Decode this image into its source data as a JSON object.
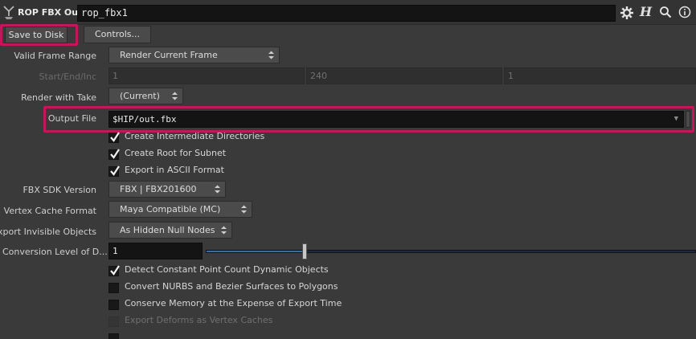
{
  "header": {
    "node_type": "ROP FBX Output",
    "node_name": "rop_fbx1",
    "icons": [
      "gear-icon",
      "help-icon",
      "search-icon",
      "info-icon"
    ]
  },
  "buttons": {
    "save_to_disk": "Save to Disk",
    "controls": "Controls..."
  },
  "params": {
    "valid_frame_range": {
      "label": "Valid Frame Range",
      "value": "Render Current Frame"
    },
    "start_end_inc": {
      "label": "Start/End/Inc",
      "start": "1",
      "end": "240",
      "inc": "1"
    },
    "render_with_take": {
      "label": "Render with Take",
      "value": "(Current)"
    },
    "output_file": {
      "label": "Output File",
      "value": "$HIP/out.fbx"
    },
    "create_intermediate_dirs": {
      "label": "Create Intermediate Directories",
      "checked": true
    },
    "create_root_for_subnet": {
      "label": "Create Root for Subnet",
      "checked": true
    },
    "export_ascii": {
      "label": "Export in ASCII Format",
      "checked": true
    },
    "fbx_sdk_version": {
      "label": "FBX SDK Version",
      "value": "FBX | FBX201600"
    },
    "vertex_cache_format": {
      "label": "Vertex Cache Format",
      "value": "Maya Compatible (MC)"
    },
    "export_invisible": {
      "label": "Export Invisible Objects",
      "value": "As Hidden Null Nodes"
    },
    "conversion_level": {
      "label": "Conversion Level of D...",
      "value": "1",
      "slider_fraction": 0.3
    },
    "detect_constant": {
      "label": "Detect Constant Point Count Dynamic Objects",
      "checked": true
    },
    "convert_nurbs": {
      "label": "Convert NURBS and Bezier Surfaces to Polygons",
      "checked": false
    },
    "conserve_memory": {
      "label": "Conserve Memory at the Expense of Export Time",
      "checked": false
    },
    "export_deforms": {
      "label": "Export Deforms as Vertex Caches",
      "checked": false,
      "disabled": true
    }
  },
  "colors": {
    "highlight": "#c2185b",
    "background": "#3a3a3a"
  }
}
